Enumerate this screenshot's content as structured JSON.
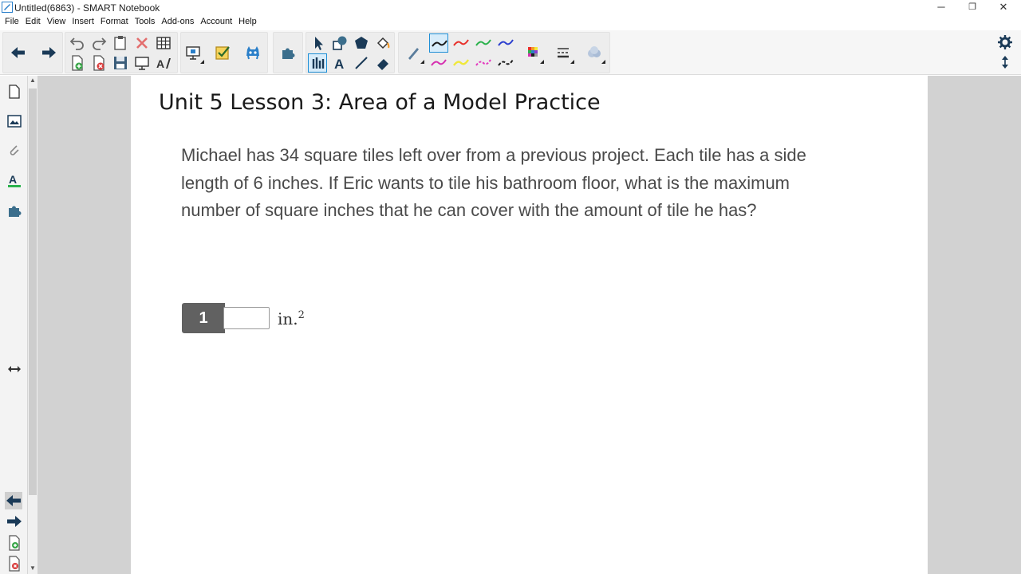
{
  "window": {
    "title": "Untitled(6863) - SMART Notebook",
    "minimize": "─",
    "restore": "❐",
    "close": "✕"
  },
  "menu": [
    "File",
    "Edit",
    "View",
    "Insert",
    "Format",
    "Tools",
    "Add-ons",
    "Account",
    "Help"
  ],
  "toolbar": {
    "icons": [
      "back-arrow-icon",
      "forward-arrow-icon",
      "undo-icon",
      "redo-icon",
      "paste-icon",
      "delete-icon",
      "table-icon",
      "add-page-icon",
      "delete-page-icon",
      "save-icon",
      "screen-shade-icon",
      "text-tools-icon",
      "document-camera-icon",
      "response-icon",
      "monster-icon",
      "add-ons-puzzle-icon",
      "select-pointer-icon",
      "shapes-icon",
      "regular-polygon-icon",
      "fill-icon",
      "pens-icon",
      "text-icon",
      "lines-icon",
      "eraser-icon",
      "magic-pen-icon",
      "pen-black",
      "pen-red",
      "pen-green",
      "pen-blue",
      "pen-magenta",
      "pen-yellow",
      "pen-pink-dashed",
      "pen-black-dashed",
      "color-grid-icon",
      "line-style-icon",
      "fill-effects-icon",
      "settings-gear-icon",
      "toolbar-move-icon"
    ],
    "pen_colors": [
      "#1a1a1a",
      "#e8302a",
      "#2bb24c",
      "#2c3fcf",
      "#d62fb0",
      "#f0e83a",
      "#e33bbf",
      "#1a1a1a"
    ],
    "accent": "#1e8fd6"
  },
  "sidebar": {
    "icons": [
      "page-sorter-icon",
      "gallery-icon",
      "attachments-icon",
      "properties-icon",
      "add-ons-icon",
      "resize-arrows-icon",
      "previous-page-icon",
      "next-page-icon",
      "add-page-icon",
      "delete-page-icon"
    ]
  },
  "page": {
    "title": "Unit 5 Lesson 3: Area of a Model Practice",
    "question": "Michael has 34 square tiles left over from a previous project. Each tile has a side length of 6 inches. If Eric wants to tile his bathroom floor, what is the maximum number of square inches that he can cover with the amount of tile he has?",
    "answer": {
      "number": "1",
      "unit": "in.",
      "unit_superscript": "2",
      "value": ""
    }
  }
}
